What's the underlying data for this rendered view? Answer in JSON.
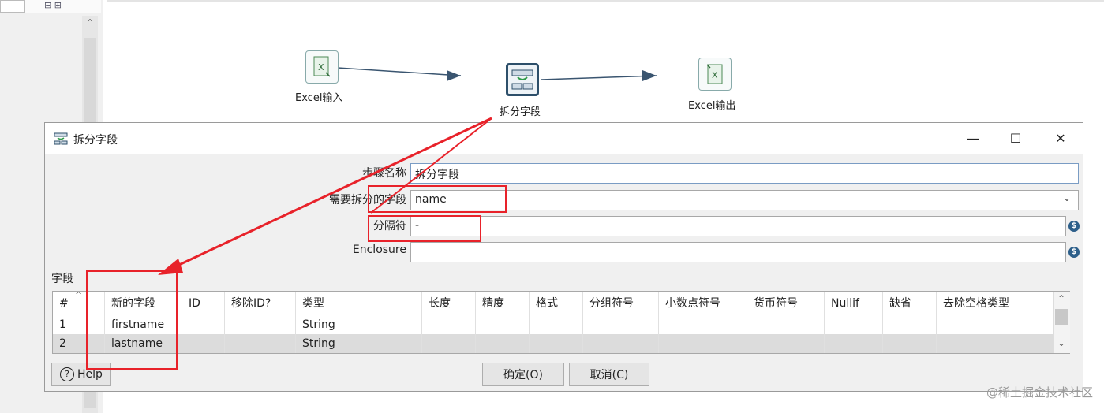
{
  "canvas": {
    "steps": [
      {
        "label": "Excel输入",
        "icon": "excel-input-icon"
      },
      {
        "label": "拆分字段",
        "icon": "split-fields-icon"
      },
      {
        "label": "Excel输出",
        "icon": "excel-output-icon"
      }
    ]
  },
  "dialog": {
    "title": "拆分字段",
    "window_buttons": {
      "minimize": "—",
      "maximize": "☐",
      "close": "✕"
    },
    "fields": {
      "step_name": {
        "label": "步骤名称",
        "value": "拆分字段"
      },
      "split_field": {
        "label": "需要拆分的字段",
        "value": "name"
      },
      "delimiter": {
        "label": "分隔符",
        "value": "-"
      },
      "enclosure": {
        "label": "Enclosure",
        "value": ""
      }
    },
    "fields_section_label": "字段",
    "table": {
      "columns": [
        "#",
        "新的字段",
        "ID",
        "移除ID?",
        "类型",
        "长度",
        "精度",
        "格式",
        "分组符号",
        "小数点符号",
        "货币符号",
        "Nullif",
        "缺省",
        "去除空格类型"
      ],
      "rows": [
        {
          "num": "1",
          "name": "firstname",
          "type": "String"
        },
        {
          "num": "2",
          "name": "lastname",
          "type": "String"
        }
      ]
    },
    "buttons": {
      "help": "Help",
      "ok": "确定(O)",
      "cancel": "取消(C)"
    }
  },
  "watermark": "@稀土掘金技术社区",
  "colors": {
    "accent": "#2d5f8a",
    "annotation": "#e8222a",
    "hop": "#3a5570"
  }
}
